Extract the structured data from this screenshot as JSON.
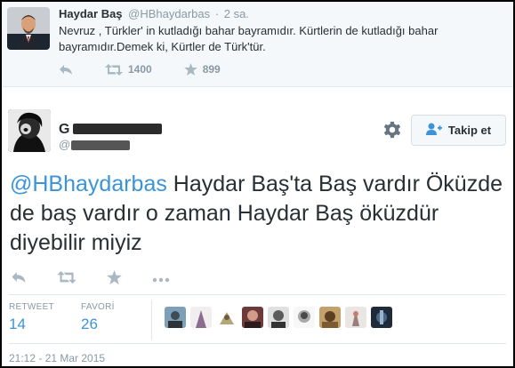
{
  "parent_tweet": {
    "name": "Haydar Baş",
    "handle": "@HBhaydarbas",
    "separator": "·",
    "time": "2 sa.",
    "text": "Nevruz , Türkler' in kutladığı bahar bayramıdır. Kürtlerin de kutladığı bahar bayramıdır.Demek ki, Kürtler de Türk'tür.",
    "retweet_count": "1400",
    "favorite_count": "899",
    "icons": [
      "reply-icon",
      "retweet-icon",
      "star-icon"
    ]
  },
  "main_tweet": {
    "name_visible": "G",
    "handle_visible": "@",
    "follow_label": "Takip et",
    "mention": "@HBhaydarbas",
    "text": " Haydar Baş'ta Baş vardır Öküzde de baş vardır o zaman Haydar Baş öküzdür diyebilir miyiz",
    "stats": {
      "retweet_label": "RETWEET",
      "retweet_value": "14",
      "favorite_label": "FAVORİ",
      "favorite_value": "26"
    },
    "timestamp": "21:12 - 21 Mar 2015",
    "icons": [
      "gear-icon",
      "follow-person-icon",
      "reply-icon",
      "retweet-icon",
      "star-icon",
      "more-icon"
    ]
  },
  "colors": {
    "link_blue": "#3b94d9",
    "muted_gray": "#8899a6",
    "text_dark": "#292f33",
    "parent_bg": "#f5f8fa",
    "border": "#e1e8ed"
  }
}
